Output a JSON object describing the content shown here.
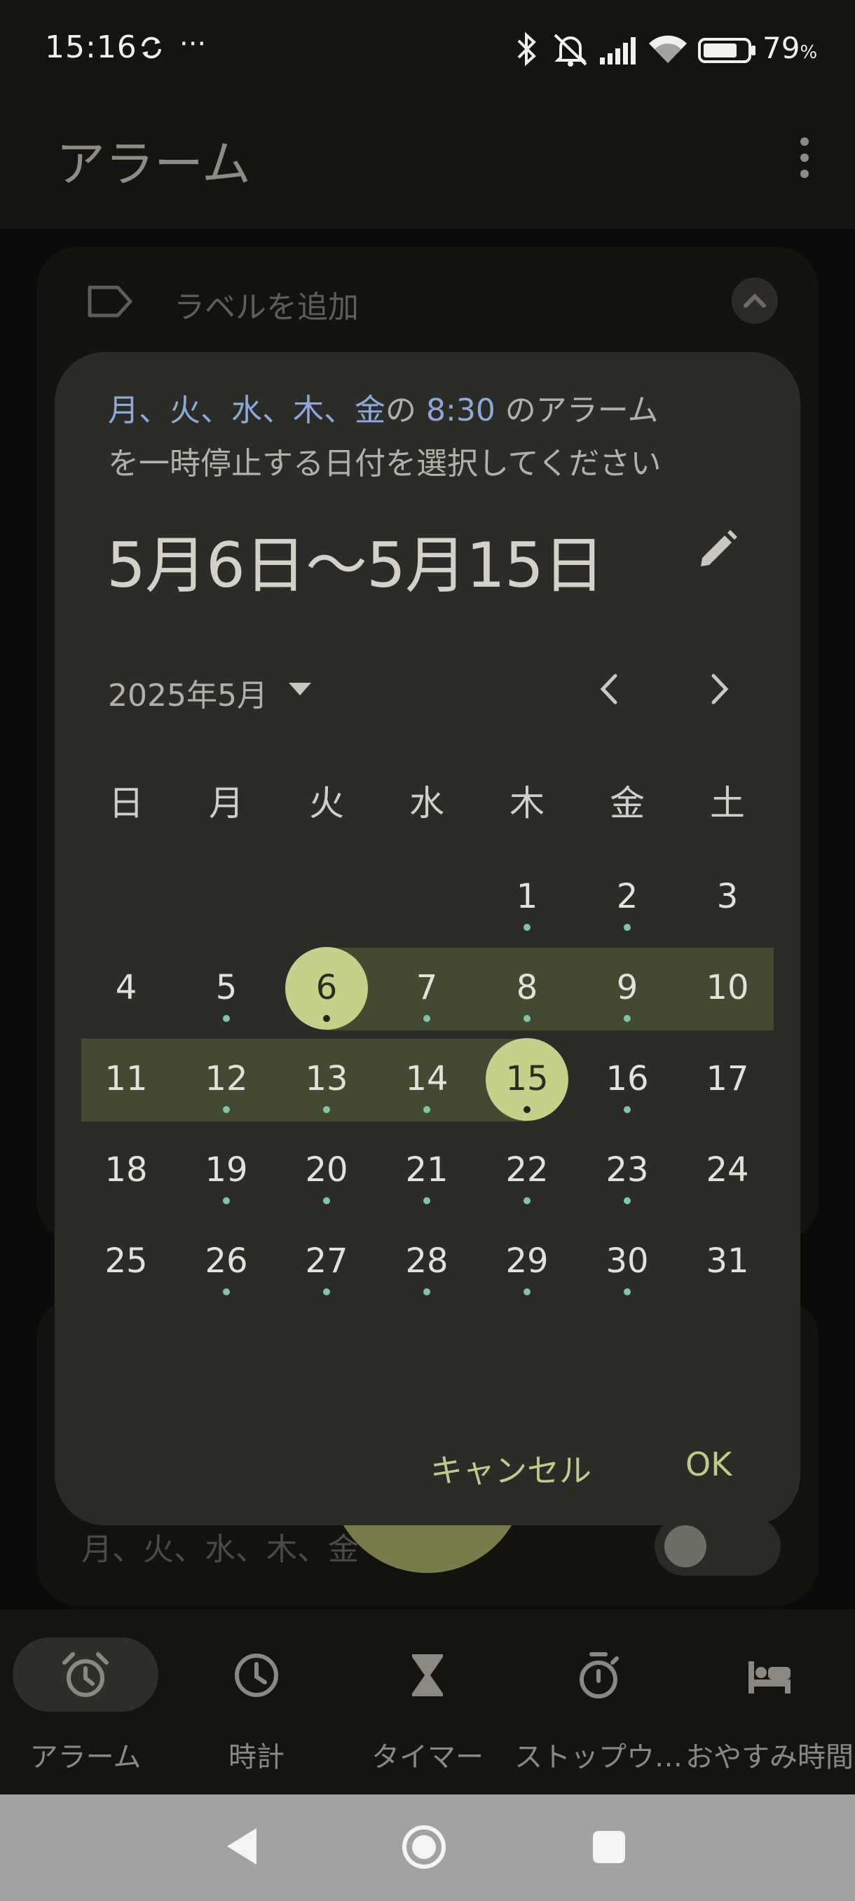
{
  "status_bar": {
    "time": "15:16",
    "more": "···",
    "battery_percent": "79",
    "battery_unit": "%",
    "battery_level": 0.79,
    "icons": [
      "sync-icon",
      "bluetooth-icon",
      "mute-icon",
      "signal-icon",
      "wifi-icon",
      "battery-icon"
    ]
  },
  "app_bar": {
    "title": "アラーム",
    "menu_icon": "overflow-menu-icon"
  },
  "background_card": {
    "label_placeholder": "ラベルを追加",
    "repeat_days": "月、火、水、木、金"
  },
  "dialog": {
    "headline_days": "月、火、水、木、金",
    "headline_mid": "の ",
    "headline_time": "8:30",
    "headline_rest": " のアラームを一時停止する日付を選択してください",
    "date_range": "5月6日〜5月15日",
    "month_label": "2025年5月",
    "weekdays": [
      "日",
      "月",
      "火",
      "水",
      "木",
      "金",
      "土"
    ],
    "days": [
      "1",
      "2",
      "3",
      "4",
      "5",
      "6",
      "7",
      "8",
      "9",
      "10",
      "11",
      "12",
      "13",
      "14",
      "15",
      "16",
      "17",
      "18",
      "19",
      "20",
      "21",
      "22",
      "23",
      "24",
      "25",
      "26",
      "27",
      "28",
      "29",
      "30",
      "31"
    ],
    "first_weekday_index": 4,
    "range_start": 6,
    "range_end": 15,
    "dotted_days": [
      1,
      2,
      5,
      6,
      7,
      8,
      9,
      12,
      13,
      14,
      15,
      16,
      19,
      20,
      21,
      22,
      23,
      26,
      27,
      28,
      29,
      30
    ],
    "cancel_label": "キャンセル",
    "ok_label": "OK",
    "colors": {
      "selected": "#c6d08a",
      "range": "#444a31",
      "dot": "#7fc6a8",
      "accent_text": "#8ea9d8"
    }
  },
  "bottom_nav": {
    "items": [
      {
        "label": "アラーム",
        "icon": "alarm-clock-icon",
        "active": true
      },
      {
        "label": "時計",
        "icon": "clock-icon",
        "active": false
      },
      {
        "label": "タイマー",
        "icon": "hourglass-icon",
        "active": false
      },
      {
        "label": "ストップウ…",
        "icon": "stopwatch-icon",
        "active": false
      },
      {
        "label": "おやすみ時間",
        "icon": "bed-icon",
        "active": false
      }
    ]
  },
  "system_nav": {
    "icons": [
      "back-icon",
      "home-icon",
      "recents-icon"
    ]
  }
}
